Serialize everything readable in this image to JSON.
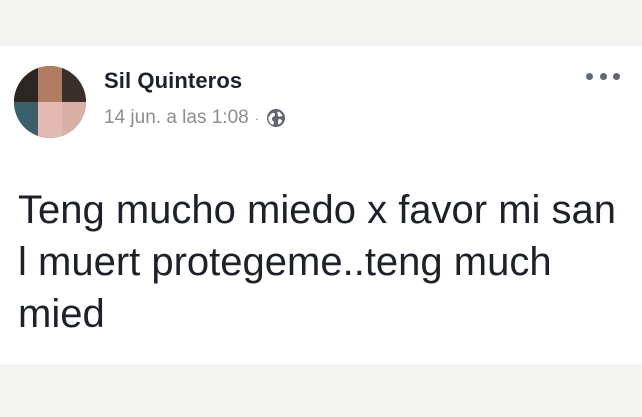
{
  "post": {
    "author": "Sil Quinteros",
    "date": "14 jun. a las 1:08",
    "separator": "·",
    "audience_icon": "globe-icon",
    "more_icon": "more-options-icon",
    "text": "Teng mucho miedo x favor mi san l muert protegeme..teng much mied"
  },
  "colors": {
    "background": "#f4f4f2",
    "card": "#ffffff",
    "author_text": "#1d2129",
    "meta_text": "#8a8d91",
    "icon": "#606770"
  }
}
